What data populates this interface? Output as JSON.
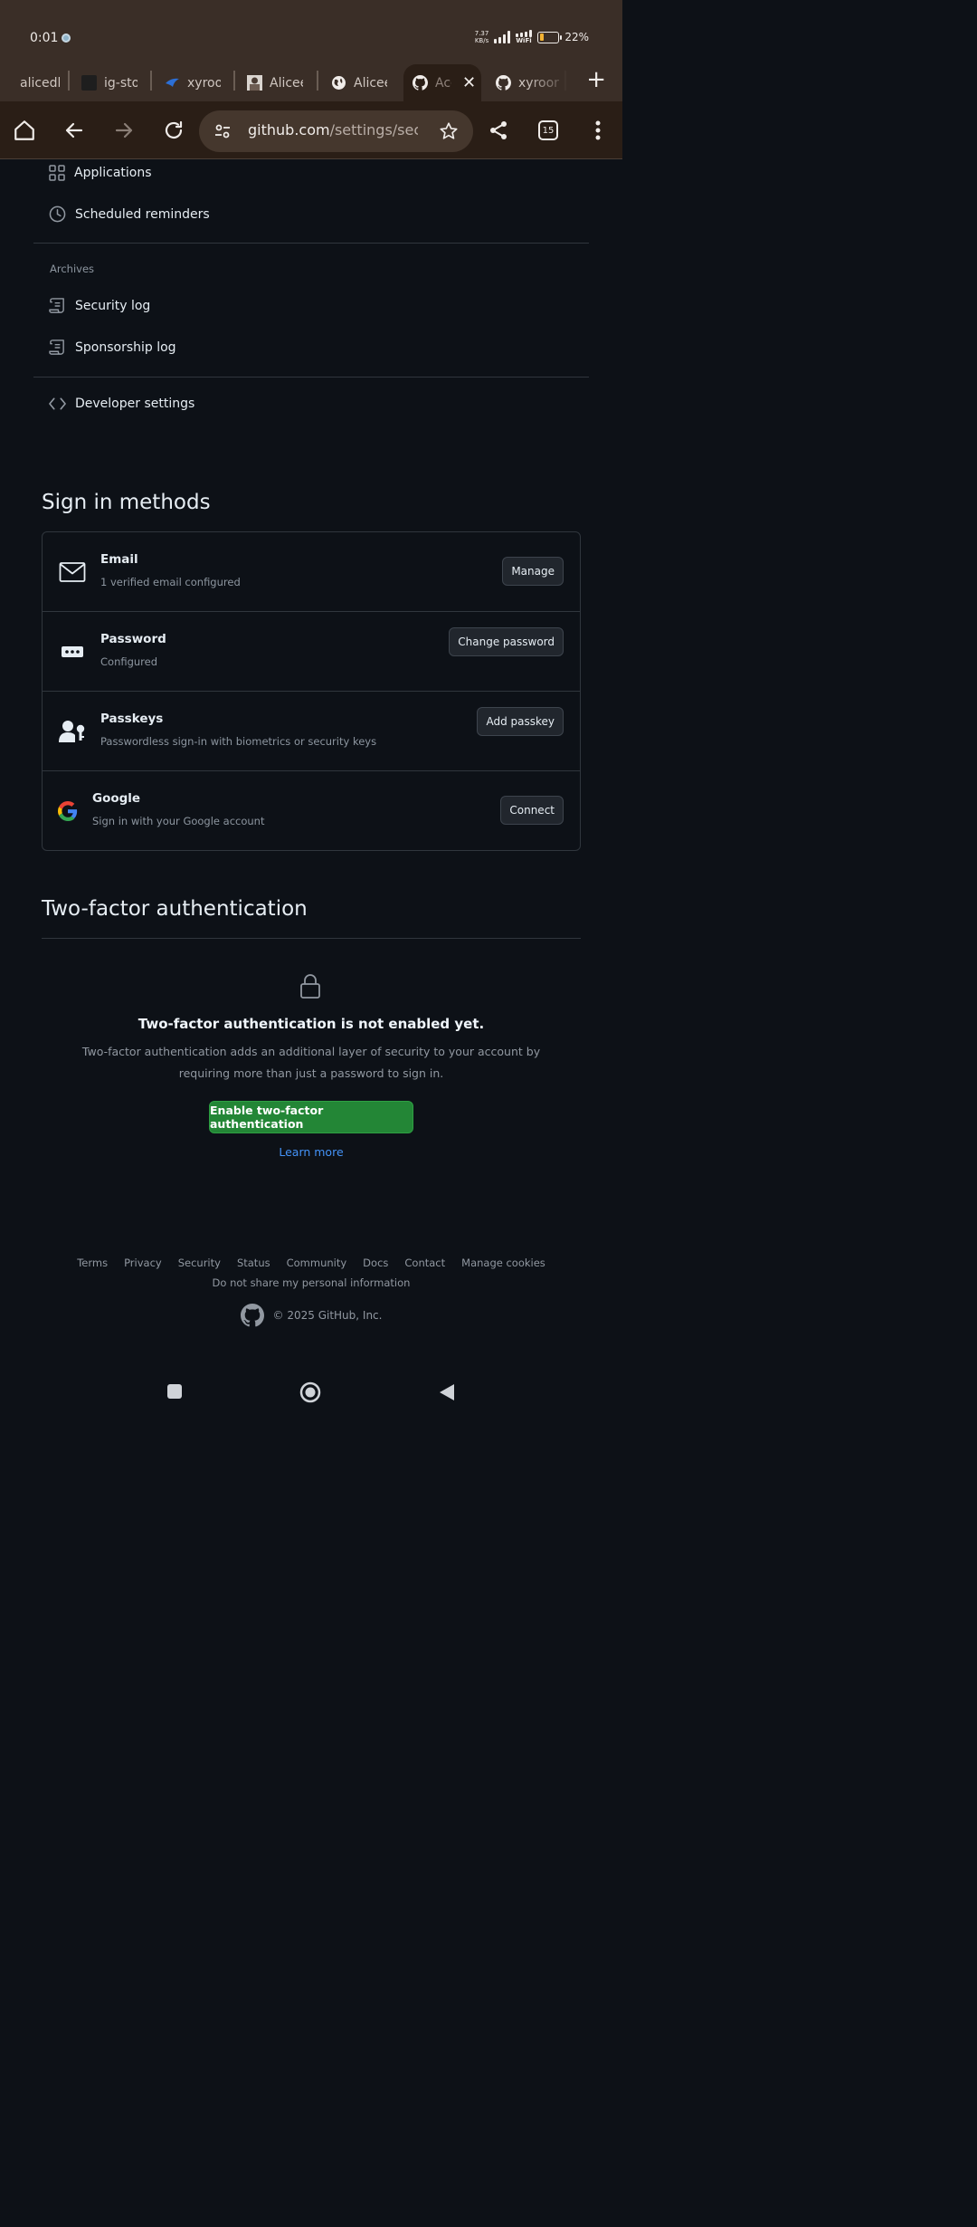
{
  "status_bar": {
    "time": "0:01",
    "net_speed_value": "7.37",
    "net_speed_unit": "KB/s",
    "wifi_label": "WiFi",
    "battery_percent": "22%",
    "battery_level": 0.22
  },
  "tabs": [
    {
      "title": "alicedl",
      "icon": "generic-favicon"
    },
    {
      "title": "ig-stor",
      "icon": "dark-square-favicon"
    },
    {
      "title": "xyroor",
      "icon": "bird-favicon"
    },
    {
      "title": "Alicee",
      "icon": "avatar-favicon"
    },
    {
      "title": "Alicee",
      "icon": "globe-icon"
    },
    {
      "title": "Acc",
      "icon": "github-icon",
      "active": true
    },
    {
      "title": "xyroor",
      "icon": "github-icon"
    }
  ],
  "toolbar": {
    "url_host": "github.com",
    "url_path": "/settings/security",
    "tab_count": "15"
  },
  "sidebar": {
    "items_top": [
      {
        "label": "Applications",
        "icon": "apps-grid-icon"
      },
      {
        "label": "Scheduled reminders",
        "icon": "clock-icon"
      }
    ],
    "archives_heading": "Archives",
    "archives_items": [
      {
        "label": "Security log",
        "icon": "log-icon"
      },
      {
        "label": "Sponsorship log",
        "icon": "log-icon"
      }
    ],
    "developer": {
      "label": "Developer settings",
      "icon": "code-icon"
    }
  },
  "sign_in": {
    "heading": "Sign in methods",
    "methods": [
      {
        "title": "Email",
        "desc": "1 verified email configured",
        "button": "Manage",
        "icon": "mail-icon"
      },
      {
        "title": "Password",
        "desc": "Configured",
        "button": "Change password",
        "icon": "password-icon"
      },
      {
        "title": "Passkeys",
        "desc": "Passwordless sign-in with biometrics or security keys",
        "button": "Add passkey",
        "icon": "passkey-icon"
      },
      {
        "title": "Google",
        "desc": "Sign in with your Google account",
        "button": "Connect",
        "icon": "google-icon"
      }
    ]
  },
  "two_factor": {
    "heading": "Two-factor authentication",
    "status_title": "Two-factor authentication is not enabled yet.",
    "description": "Two-factor authentication adds an additional layer of security to your account by requiring more than just a password to sign in.",
    "enable_button": "Enable two-factor authentication",
    "learn_more": "Learn more"
  },
  "footer": {
    "links": [
      "Terms",
      "Privacy",
      "Security",
      "Status",
      "Community",
      "Docs",
      "Contact",
      "Manage cookies"
    ],
    "privacy_link": "Do not share my personal information",
    "copyright": "© 2025 GitHub, Inc."
  },
  "colors": {
    "page_bg": "#0d1117",
    "browser_chrome": "#3a2e27",
    "primary_button": "#238636",
    "link": "#4493f8"
  }
}
